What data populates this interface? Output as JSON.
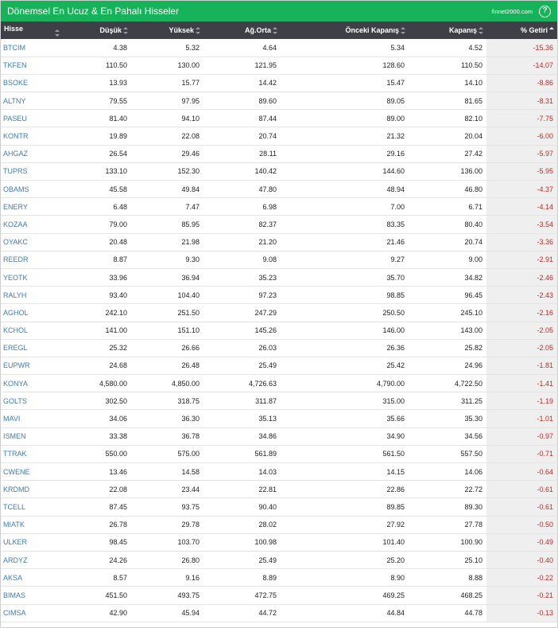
{
  "header": {
    "title": "Dönemsel En Ucuz & En Pahalı Hisseler",
    "brand": "finnet2000.com",
    "help_glyph": "?"
  },
  "columns": [
    "Hisse",
    "Düşük",
    "Yüksek",
    "Ağ.Orta",
    "Önceki Kapanış",
    "Kapanış",
    "% Getiri"
  ],
  "rows": [
    [
      "BTCIM",
      "4.38",
      "5.32",
      "4.64",
      "5.34",
      "4.52",
      "-15.36"
    ],
    [
      "TKFEN",
      "110.50",
      "130.00",
      "121.95",
      "128.60",
      "110.50",
      "-14.07"
    ],
    [
      "BSOKE",
      "13.93",
      "15.77",
      "14.42",
      "15.47",
      "14.10",
      "-8.86"
    ],
    [
      "ALTNY",
      "79.55",
      "97.95",
      "89.60",
      "89.05",
      "81.65",
      "-8.31"
    ],
    [
      "PASEU",
      "81.40",
      "94.10",
      "87.44",
      "89.00",
      "82.10",
      "-7.75"
    ],
    [
      "KONTR",
      "19.89",
      "22.08",
      "20.74",
      "21.32",
      "20.04",
      "-6.00"
    ],
    [
      "AHGAZ",
      "26.54",
      "29.46",
      "28.11",
      "29.16",
      "27.42",
      "-5.97"
    ],
    [
      "TUPRS",
      "133.10",
      "152.30",
      "140.42",
      "144.60",
      "136.00",
      "-5.95"
    ],
    [
      "OBAMS",
      "45.58",
      "49.84",
      "47.80",
      "48.94",
      "46.80",
      "-4.37"
    ],
    [
      "ENERY",
      "6.48",
      "7.47",
      "6.98",
      "7.00",
      "6.71",
      "-4.14"
    ],
    [
      "KOZAA",
      "79.00",
      "85.95",
      "82.37",
      "83.35",
      "80.40",
      "-3.54"
    ],
    [
      "OYAKC",
      "20.48",
      "21.98",
      "21.20",
      "21.46",
      "20.74",
      "-3.36"
    ],
    [
      "REEDR",
      "8.87",
      "9.30",
      "9.08",
      "9.27",
      "9.00",
      "-2.91"
    ],
    [
      "YEOTK",
      "33.96",
      "36.94",
      "35.23",
      "35.70",
      "34.82",
      "-2.46"
    ],
    [
      "RALYH",
      "93.40",
      "104.40",
      "97.23",
      "98.85",
      "96.45",
      "-2.43"
    ],
    [
      "AGHOL",
      "242.10",
      "251.50",
      "247.29",
      "250.50",
      "245.10",
      "-2.16"
    ],
    [
      "KCHOL",
      "141.00",
      "151.10",
      "145.26",
      "146.00",
      "143.00",
      "-2.05"
    ],
    [
      "EREGL",
      "25.32",
      "26.66",
      "26.03",
      "26.36",
      "25.82",
      "-2.05"
    ],
    [
      "EUPWR",
      "24.68",
      "26.48",
      "25.49",
      "25.42",
      "24.96",
      "-1.81"
    ],
    [
      "KONYA",
      "4,580.00",
      "4,850.00",
      "4,726.63",
      "4,790.00",
      "4,722.50",
      "-1.41"
    ],
    [
      "GOLTS",
      "302.50",
      "318.75",
      "311.87",
      "315.00",
      "311.25",
      "-1.19"
    ],
    [
      "MAVI",
      "34.06",
      "36.30",
      "35.13",
      "35.66",
      "35.30",
      "-1.01"
    ],
    [
      "ISMEN",
      "33.38",
      "36.78",
      "34.86",
      "34.90",
      "34.56",
      "-0.97"
    ],
    [
      "TTRAK",
      "550.00",
      "575.00",
      "561.89",
      "561.50",
      "557.50",
      "-0.71"
    ],
    [
      "CWENE",
      "13.46",
      "14.58",
      "14.03",
      "14.15",
      "14.06",
      "-0.64"
    ],
    [
      "KRDMD",
      "22.08",
      "23.44",
      "22.81",
      "22.86",
      "22.72",
      "-0.61"
    ],
    [
      "TCELL",
      "87.45",
      "93.75",
      "90.40",
      "89.85",
      "89.30",
      "-0.61"
    ],
    [
      "MIATK",
      "26.78",
      "29.78",
      "28.02",
      "27.92",
      "27.78",
      "-0.50"
    ],
    [
      "ULKER",
      "98.45",
      "103.70",
      "100.98",
      "101.40",
      "100.90",
      "-0.49"
    ],
    [
      "ARDYZ",
      "24.26",
      "26.80",
      "25.49",
      "25.20",
      "25.10",
      "-0.40"
    ],
    [
      "AKSA",
      "8.57",
      "9.16",
      "8.89",
      "8.90",
      "8.88",
      "-0.22"
    ],
    [
      "BIMAS",
      "451.50",
      "493.75",
      "472.75",
      "469.25",
      "468.25",
      "-0.21"
    ],
    [
      "CIMSA",
      "42.90",
      "45.94",
      "44.72",
      "44.84",
      "44.78",
      "-0.13"
    ]
  ],
  "colors": {
    "header_bg": "#17b35a",
    "table_header_bg": "#3f3f48",
    "symbol_link": "#3d7bb7",
    "negative_return": "#c62828",
    "return_column_bg": "#efefef"
  }
}
